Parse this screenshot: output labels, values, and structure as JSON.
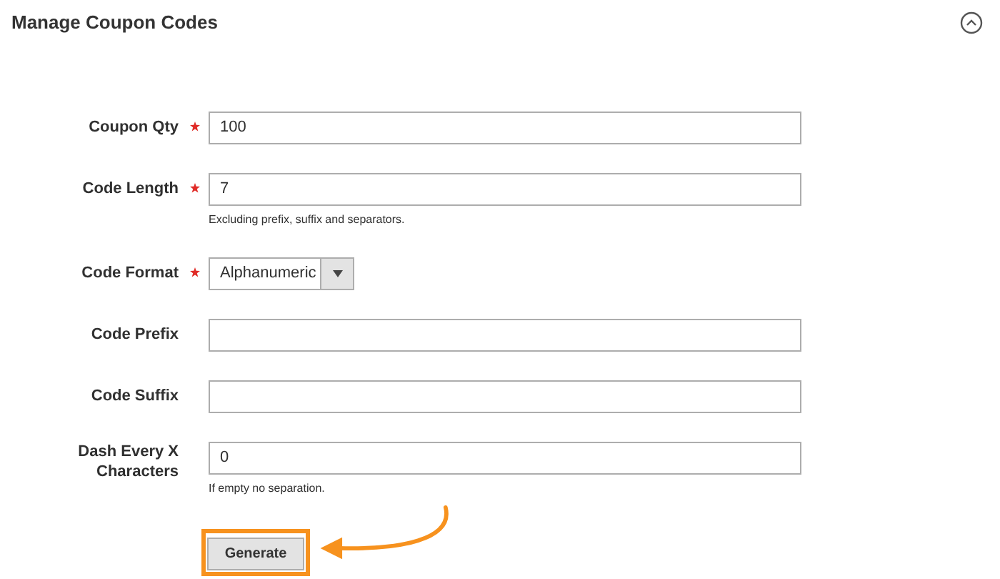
{
  "section": {
    "title": "Manage Coupon Codes",
    "expanded": true
  },
  "fields": [
    {
      "kind": "text",
      "label": "Coupon Qty",
      "required": true,
      "value": "100"
    },
    {
      "kind": "text",
      "label": "Code Length",
      "required": true,
      "value": "7",
      "hint": "Excluding prefix, suffix and separators."
    },
    {
      "kind": "select",
      "label": "Code Format",
      "required": true,
      "value": "Alphanumeric"
    },
    {
      "kind": "text",
      "label": "Code Prefix",
      "required": false
    },
    {
      "kind": "text",
      "label": "Code Suffix",
      "required": false
    },
    {
      "kind": "text",
      "label": "Dash Every X Characters",
      "required": false,
      "value": "0",
      "hint": "If empty no separation."
    }
  ],
  "generate_button": {
    "label": "Generate",
    "highlighted": true
  }
}
